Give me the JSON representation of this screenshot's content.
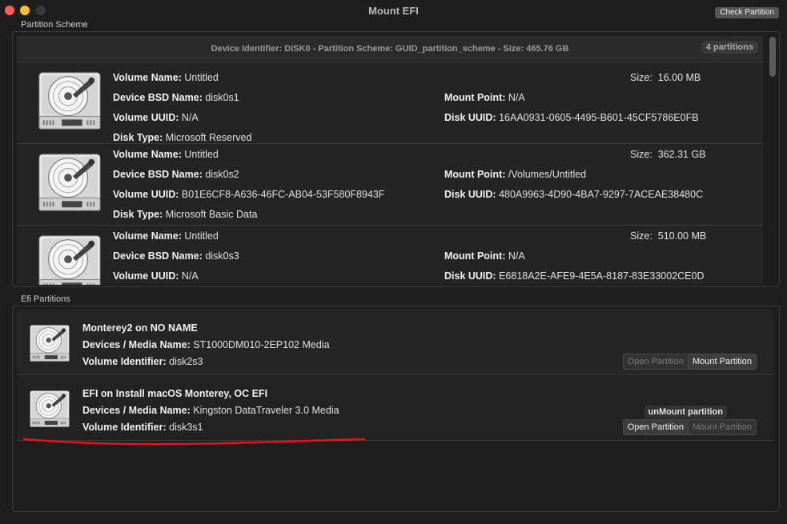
{
  "window": {
    "title": "Mount EFI",
    "check_button": "Check Partition"
  },
  "scheme": {
    "label": "Partition Scheme",
    "header": "Device Identifier: DISK0 - Partition Scheme: GUID_partition_scheme - Size: 465.76 GB",
    "badge": "4 partitions",
    "labels": {
      "volume_name": "Volume Name:",
      "bsd_name": "Device BSD Name:",
      "volume_uuid": "Volume UUID:",
      "disk_type": "Disk Type:",
      "size": "Size:",
      "mount_point": "Mount Point:",
      "disk_uuid": "Disk UUID:"
    },
    "partitions": [
      {
        "volume_name": "Untitled",
        "bsd_name": "disk0s1",
        "volume_uuid": "N/A",
        "disk_type": "Microsoft Reserved",
        "size": "16.00 MB",
        "mount_point": "N/A",
        "disk_uuid": "16AA0931-0605-4495-B601-45CF5786E0FB"
      },
      {
        "volume_name": "Untitled",
        "bsd_name": "disk0s2",
        "volume_uuid": "B01E6CF8-A636-46FC-AB04-53F580F8943F",
        "disk_type": "Microsoft Basic Data",
        "size": "362.31 GB",
        "mount_point": "/Volumes/Untitled",
        "disk_uuid": "480A9963-4D90-4BA7-9297-7ACEAE38480C"
      },
      {
        "volume_name": "Untitled",
        "bsd_name": "disk0s3",
        "volume_uuid": "N/A",
        "size": "510.00 MB",
        "mount_point": "N/A",
        "disk_uuid": "E6818A2E-AFE9-4E5A-8187-83E33002CE0D"
      }
    ]
  },
  "efi": {
    "label": "Efi Partitions",
    "labels": {
      "media": "Devices / Media Name:",
      "vol_id": "Volume Identifier:"
    },
    "buttons": {
      "open": "Open Partition",
      "mount": "Mount Partition",
      "unmount": "unMount partition"
    },
    "items": [
      {
        "title": "Monterey2 on NO NAME",
        "media": "ST1000DM010-2EP102 Media",
        "vol_id": "disk2s3"
      },
      {
        "title": "EFI on Install macOS Monterey, OC EFI",
        "media": "Kingston DataTraveler 3.0 Media",
        "vol_id": "disk3s1"
      }
    ]
  },
  "annotation_color": "#e0161b"
}
